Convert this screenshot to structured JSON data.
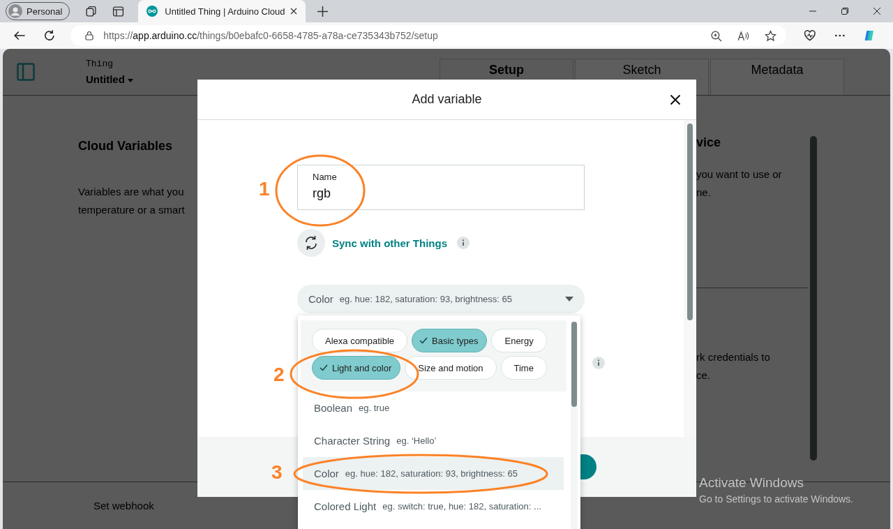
{
  "browser": {
    "profile": "Personal",
    "tab_title": "Untitled Thing | Arduino Cloud",
    "url_scheme": "https://",
    "url_host": "app.arduino.cc",
    "url_path": "/things/b0ebafc0-6658-4785-a78a-ce735343b752/setup"
  },
  "header": {
    "label": "Thing",
    "thing_name": "Untitled",
    "tabs": [
      {
        "label": "Setup",
        "selected": true
      },
      {
        "label": "Sketch",
        "selected": false
      },
      {
        "label": "Metadata",
        "selected": false
      }
    ]
  },
  "left_panel": {
    "title": "Cloud Variables",
    "text": [
      "Variables are what you",
      "temperature or a smart"
    ],
    "footer_link": "Set webhook"
  },
  "right_panel": {
    "title": "vice",
    "text": [
      "you want to use or",
      "ne."
    ],
    "text_2": [
      "rk credentials to",
      "ce."
    ]
  },
  "dialog": {
    "title": "Add variable",
    "name_field": {
      "label": "Name",
      "value": "rgb"
    },
    "sync_label": "Sync with other Things",
    "type_select": {
      "value": "Color",
      "hint": "eg. hue: 182, saturation: 93, brightness: 65"
    }
  },
  "dropdown": {
    "filters": [
      {
        "label": "Alexa compatible",
        "selected": false
      },
      {
        "label": "Basic types",
        "selected": true
      },
      {
        "label": "Energy",
        "selected": false
      },
      {
        "label": "Light and color",
        "selected": true
      },
      {
        "label": "Size and motion",
        "selected": false
      },
      {
        "label": "Time",
        "selected": false
      }
    ],
    "options": [
      {
        "name": "Boolean",
        "example": "eg. true",
        "selected": false
      },
      {
        "name": "Character String",
        "example": "eg. ‘Hello’",
        "selected": false
      },
      {
        "name": "Color",
        "example": "eg. hue: 182, saturation: 93, brightness: 65",
        "selected": true
      },
      {
        "name": "Colored Light",
        "example": "eg. switch: true, hue: 182, saturation: ...",
        "selected": false
      }
    ]
  },
  "annotations": [
    {
      "number": "1"
    },
    {
      "number": "2"
    },
    {
      "number": "3"
    }
  ],
  "os_notice": {
    "title": "Activate Windows",
    "text": "Go to Settings to activate Windows."
  }
}
